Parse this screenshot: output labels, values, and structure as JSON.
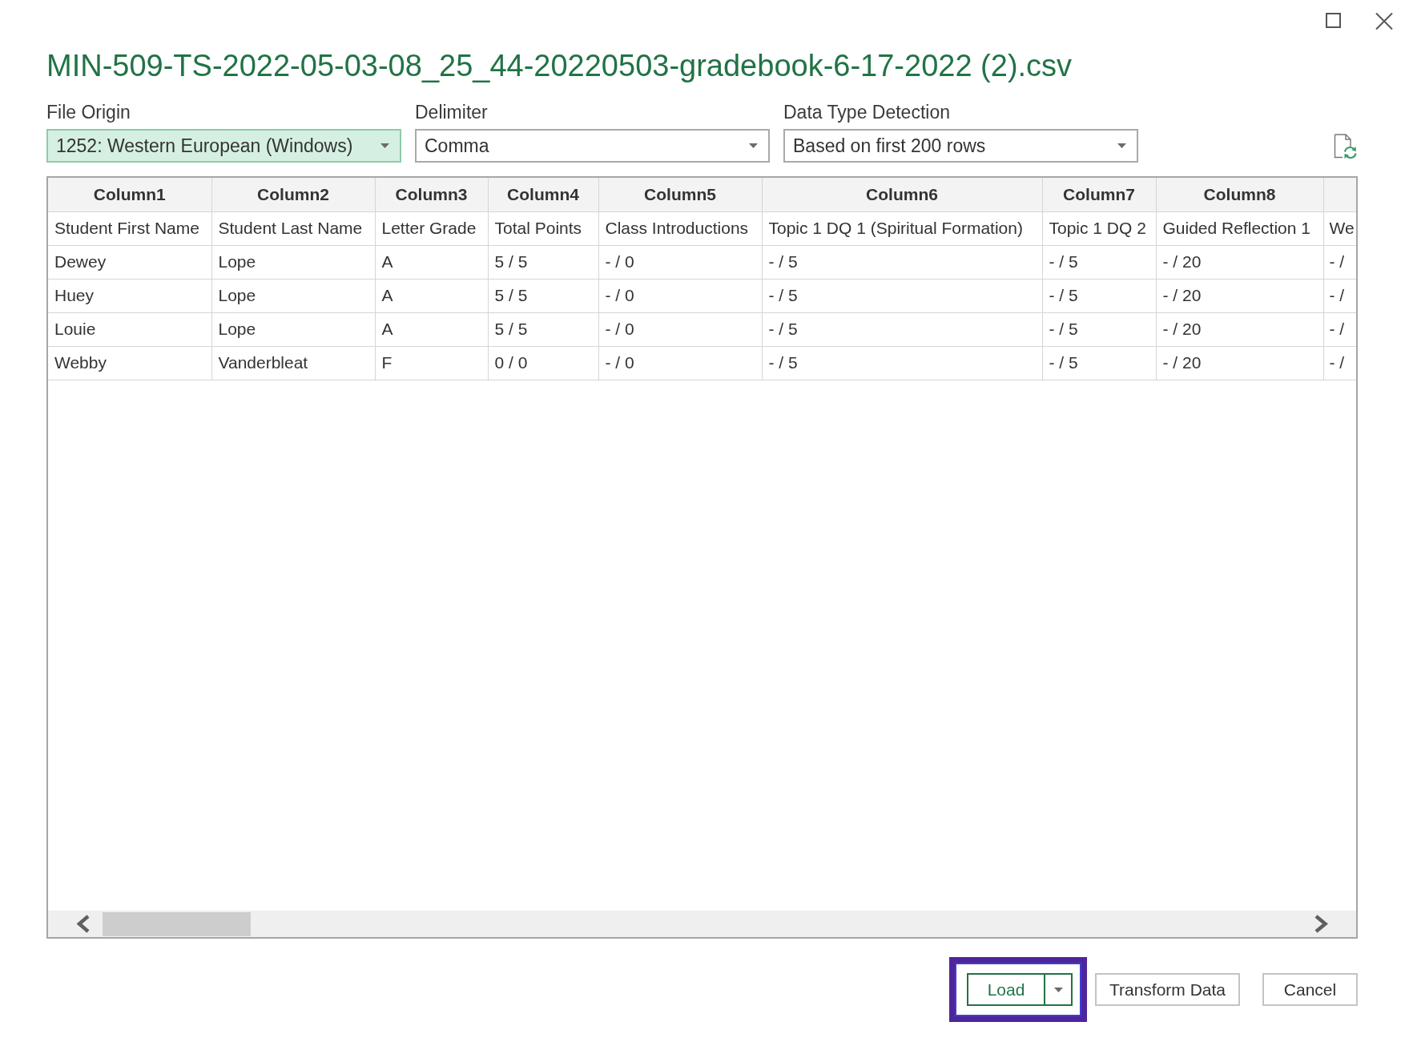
{
  "window": {
    "title": "MIN-509-TS-2022-05-03-08_25_44-20220503-gradebook-6-17-2022 (2).csv"
  },
  "options": [
    {
      "label": "File Origin",
      "value": "1252: Western European (Windows)",
      "focused": true
    },
    {
      "label": "Delimiter",
      "value": "Comma",
      "focused": false
    },
    {
      "label": "Data Type Detection",
      "value": "Based on first 200 rows",
      "focused": false
    }
  ],
  "preview": {
    "columns": [
      "Column1",
      "Column2",
      "Column3",
      "Column4",
      "Column5",
      "Column6",
      "Column7",
      "Column8"
    ],
    "rows": [
      [
        "Student First Name",
        "Student Last Name",
        "Letter Grade",
        "Total Points",
        "Class Introductions",
        "Topic 1 DQ 1 (Spiritual Formation)",
        "Topic 1 DQ 2",
        "Guided Reflection 1",
        "We"
      ],
      [
        "Dewey",
        "Lope",
        "A",
        "5 / 5",
        "- / 0",
        "- / 5",
        "- / 5",
        "- / 20",
        "- /"
      ],
      [
        "Huey",
        "Lope",
        "A",
        "5 / 5",
        "- / 0",
        "- / 5",
        "- / 5",
        "- / 20",
        "- /"
      ],
      [
        "Louie",
        "Lope",
        "A",
        "5 / 5",
        "- / 0",
        "- / 5",
        "- / 5",
        "- / 20",
        "- /"
      ],
      [
        "Webby",
        "Vanderbleat",
        "F",
        "0 / 0",
        "- / 0",
        "- / 5",
        "- / 5",
        "- / 20",
        "- /"
      ]
    ]
  },
  "buttons": [
    {
      "label": "Load",
      "kind": "split",
      "default": true,
      "highlighted": true
    },
    {
      "label": "Transform Data",
      "kind": "plain",
      "default": false,
      "highlighted": false
    },
    {
      "label": "Cancel",
      "kind": "plain",
      "default": false,
      "highlighted": false
    }
  ]
}
